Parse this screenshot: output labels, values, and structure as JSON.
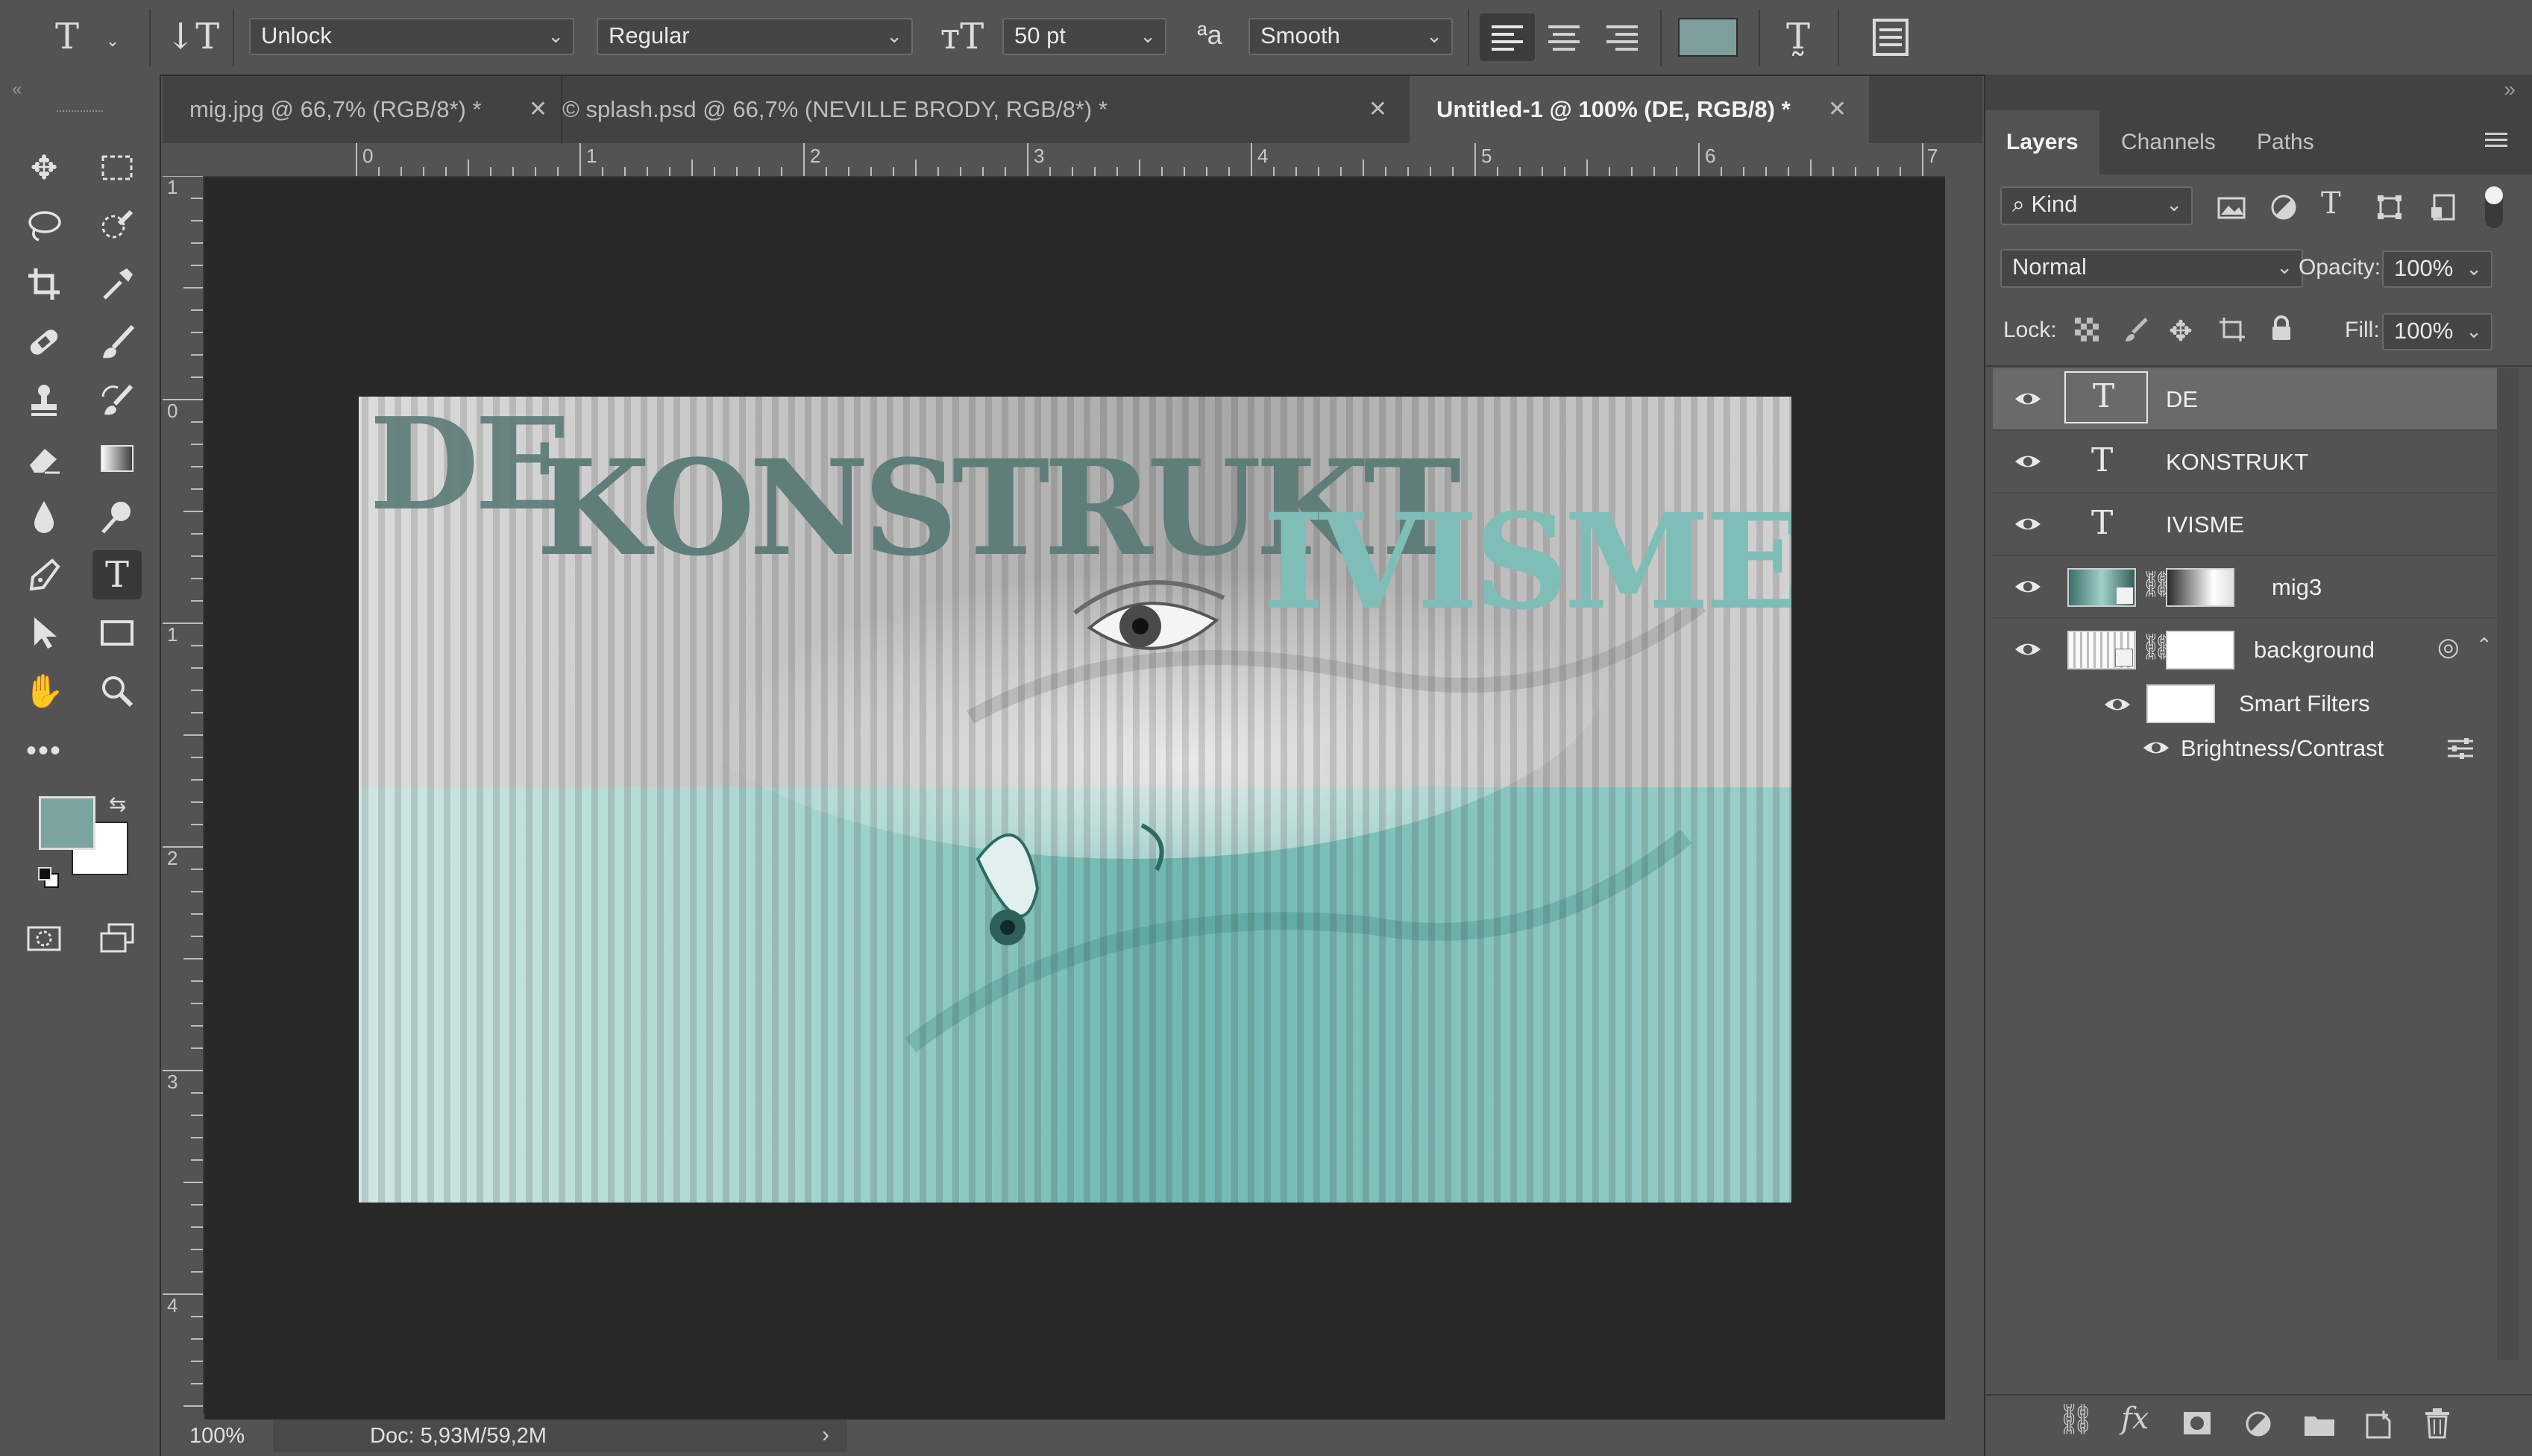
{
  "options_bar": {
    "font_family": "Unlock",
    "font_style": "Regular",
    "font_size": "50 pt",
    "antialias_label": "ªa",
    "antialias": "Smooth",
    "text_color": "#7d9e9a"
  },
  "tabs": [
    {
      "label": "mig.jpg @ 66,7% (RGB/8*) *",
      "active": false
    },
    {
      "label": "© splash.psd @ 66,7% (NEVILLE BRODY, RGB/8*) *",
      "active": false
    },
    {
      "label": "Untitled-1 @ 100% (DE, RGB/8) *",
      "active": true
    }
  ],
  "ruler": {
    "h_labels": [
      "0",
      "1",
      "2",
      "3",
      "4",
      "5",
      "6",
      "7"
    ],
    "v_labels": [
      "1",
      "0",
      "1",
      "2",
      "3",
      "4"
    ]
  },
  "artwork": {
    "word1": "DE",
    "word2": "KONSTRUKT",
    "word3": "IVISME",
    "text_color": "#5f7d79",
    "teal": "#7fbdb7"
  },
  "status": {
    "zoom": "100%",
    "doc": "Doc: 5,93M/59,2M"
  },
  "colors": {
    "foreground": "#7ba39f",
    "background": "#ffffff"
  },
  "layers_panel": {
    "tabs": [
      "Layers",
      "Channels",
      "Paths"
    ],
    "filter_kind": "Kind",
    "blend_mode": "Normal",
    "opacity_label": "Opacity:",
    "opacity": "100%",
    "lock_label": "Lock:",
    "fill_label": "Fill:",
    "fill": "100%",
    "layers": [
      {
        "name": "DE",
        "type": "text",
        "selected": true
      },
      {
        "name": "KONSTRUKT",
        "type": "text",
        "selected": false
      },
      {
        "name": "IVISME",
        "type": "text",
        "selected": false
      },
      {
        "name": "mig3",
        "type": "image",
        "selected": false
      },
      {
        "name": "background",
        "type": "smart",
        "selected": false
      }
    ],
    "smart_filters": "Smart Filters",
    "filter_item": "Brightness/Contrast"
  }
}
